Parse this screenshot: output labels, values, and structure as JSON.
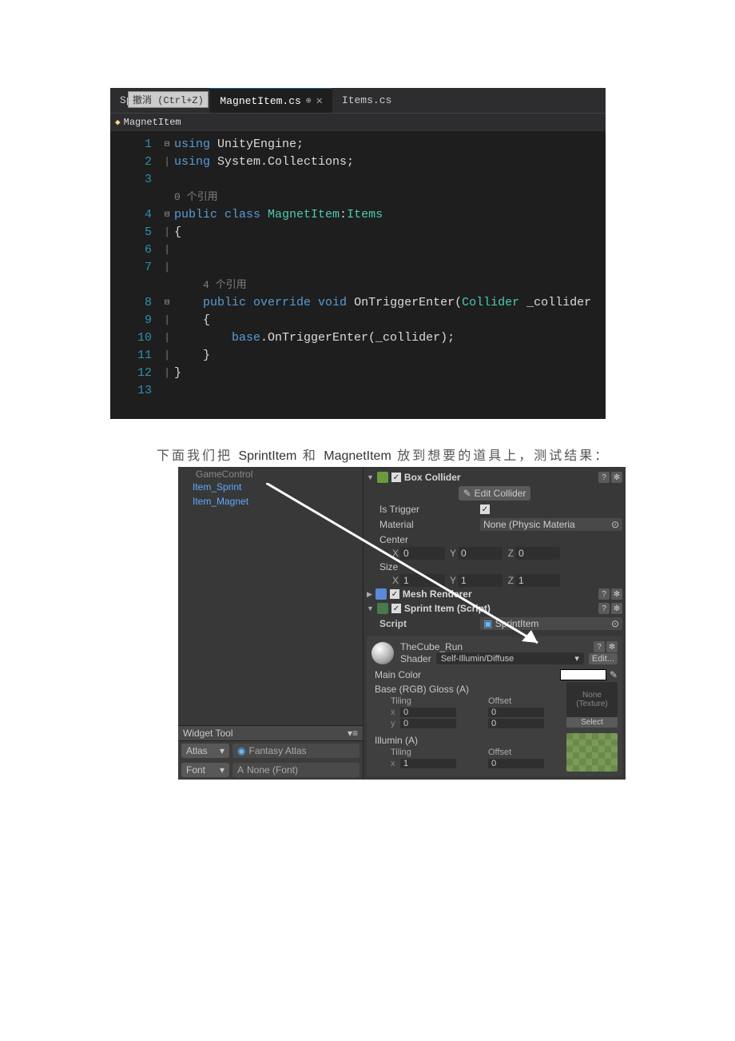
{
  "editor": {
    "tabs": [
      {
        "label": "SprintItem.cs",
        "active": false
      },
      {
        "label": "MagnetItem.cs",
        "active": true,
        "pin": "⊕",
        "close": "✕"
      },
      {
        "label": "Items.cs",
        "active": false
      }
    ],
    "undo_hint": "撤消 (Ctrl+Z)",
    "nav_text": "MagnetItem",
    "ref0": "0 个引用",
    "ref4": "4 个引用"
  },
  "code": {
    "l1a": "using ",
    "l1b": "UnityEngine",
    "l1c": ";",
    "l2a": "using ",
    "l2b": "System.Collections;",
    "l4a": "public ",
    "l4b": "class ",
    "l4c": "MagnetItem",
    "l4d": ":",
    "l4e": "Items",
    "l5": "{",
    "l8a": "    public ",
    "l8b": "override ",
    "l8c": "void ",
    "l8d": "OnTriggerEnter(",
    "l8e": "Collider",
    "l8f": " _collider",
    "l9": "    {",
    "l10a": "        base",
    "l10b": ".OnTriggerEnter(_collider);",
    "l11": "    }",
    "l12": "}"
  },
  "lines": [
    "1",
    "2",
    "3",
    "",
    "4",
    "5",
    "6",
    "7",
    "",
    "8",
    "9",
    "10",
    "11",
    "12",
    "13"
  ],
  "caption": {
    "p1": "下面我们把 ",
    "s1": "SprintItem",
    "p2": " 和 ",
    "s2": "MagnetItem",
    "p3": " 放到想要的道具上，测试结果："
  },
  "hierarchy": {
    "gc": "GameControl",
    "items": [
      "Item_Sprint",
      "Item_Magnet"
    ],
    "widget_tool": "Widget Tool",
    "atlas_label": "Atlas",
    "atlas_value": "Fantasy Atlas",
    "font_label": "Font",
    "font_value": "None (Font)"
  },
  "inspector": {
    "box_collider": "Box Collider",
    "edit_collider": "Edit Collider",
    "is_trigger": "Is Trigger",
    "material": "Material",
    "material_value": "None (Physic Materia",
    "center": "Center",
    "size": "Size",
    "center_xyz": {
      "x": "0",
      "y": "0",
      "z": "0"
    },
    "size_xyz": {
      "x": "1",
      "y": "1",
      "z": "1"
    },
    "mesh_renderer": "Mesh Renderer",
    "sprint_script": "Sprint Item (Script)",
    "script_label": "Script",
    "script_value": "SprintItem",
    "mat_name": "TheCube_Run",
    "shader_label": "Shader",
    "shader_value": "Self-Illumin/Diffuse",
    "edit_btn": "Edit...",
    "main_color": "Main Color",
    "base_rgb": "Base (RGB) Gloss (A)",
    "tiling": "Tiling",
    "offset": "Offset",
    "none_tex": "None\n(Texture)",
    "select": "Select",
    "base_tiling_x": "0",
    "base_tiling_y": "0",
    "base_offset_x": "0",
    "base_offset_y": "0",
    "illumin": "Illumin (A)",
    "ill_tiling_x": "1",
    "ill_offset_x": "0"
  }
}
